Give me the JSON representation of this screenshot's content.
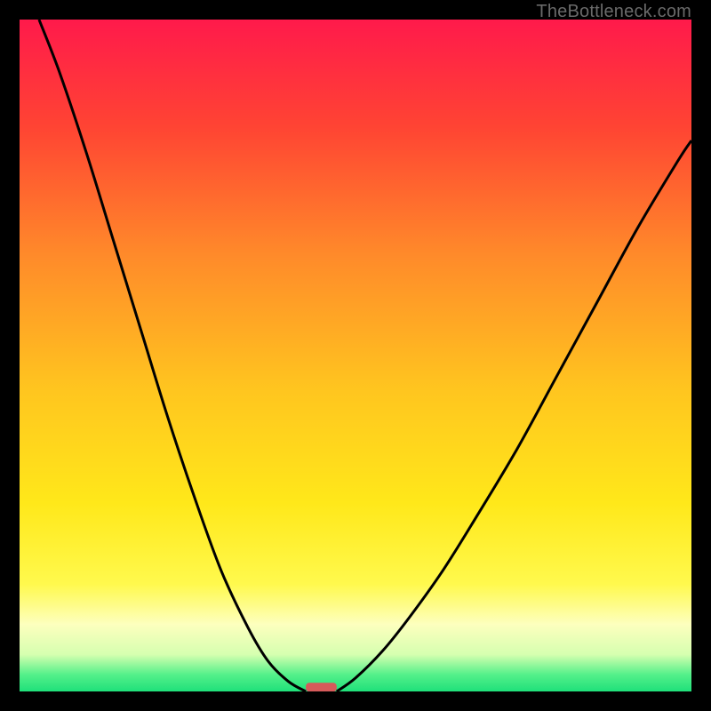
{
  "watermark": "TheBottleneck.com",
  "chart_data": {
    "type": "line",
    "title": "",
    "xlabel": "",
    "ylabel": "",
    "xlim": [
      0,
      100
    ],
    "ylim": [
      0,
      100
    ],
    "left_curve": {
      "comment": "descending convex curve from top-left down to the trough",
      "x": [
        2.9,
        6,
        10,
        14,
        18,
        22,
        26,
        30,
        34,
        37,
        40,
        42.6
      ],
      "y": [
        100,
        92,
        80,
        67,
        54,
        41,
        29,
        18,
        9.5,
        4.5,
        1.5,
        0
      ]
    },
    "right_curve": {
      "comment": "ascending concave curve from the trough up to upper-right",
      "x": [
        47.2,
        50,
        54,
        58,
        63,
        68,
        74,
        80,
        86,
        92,
        98,
        100
      ],
      "y": [
        0,
        2,
        6,
        11,
        18,
        26,
        36,
        47,
        58,
        69,
        79,
        82
      ]
    },
    "trough_marker": {
      "x_start": 42.6,
      "x_end": 47.2,
      "y": 0.5,
      "color": "#d65a5a"
    },
    "gradient_stops": [
      {
        "offset": 0.0,
        "color": "#ff1a4b"
      },
      {
        "offset": 0.16,
        "color": "#ff4433"
      },
      {
        "offset": 0.35,
        "color": "#ff8a2a"
      },
      {
        "offset": 0.55,
        "color": "#ffc51f"
      },
      {
        "offset": 0.72,
        "color": "#ffe81a"
      },
      {
        "offset": 0.84,
        "color": "#fff94d"
      },
      {
        "offset": 0.9,
        "color": "#fdffbe"
      },
      {
        "offset": 0.945,
        "color": "#d6ffb0"
      },
      {
        "offset": 0.975,
        "color": "#54f08a"
      },
      {
        "offset": 1.0,
        "color": "#1fe07a"
      }
    ]
  }
}
